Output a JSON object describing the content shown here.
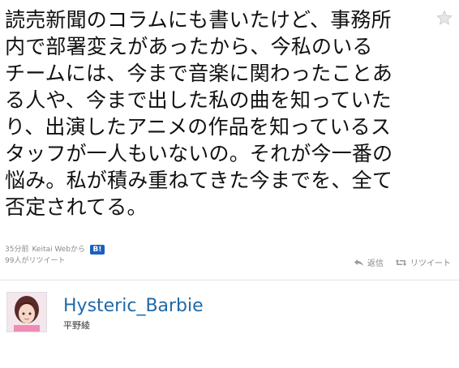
{
  "tweet": {
    "lines": [
      "読売新聞のコラムにも書いたけど、事務所",
      "内で部署変えがあったから、今私のいる",
      "チームには、今まで音楽に関わったことあ",
      "る人や、今まで出した私の曲を知っていた",
      "り、出演したアニメの作品を知っているス",
      "タッフが一人もいないの。それが今一番の",
      "悩み。私が積み重ねてきた今までを、全て",
      "否定されてる。"
    ],
    "time": "35分前",
    "source": "Keitai Webから",
    "badge": "B!",
    "retweet_count": "99人がリツイート",
    "actions": {
      "reply_label": "返信",
      "retweet_label": "リツイート"
    }
  },
  "author": {
    "screen_name": "Hysteric_Barbie",
    "real_name": "平野綾"
  },
  "colors": {
    "link": "#1f6aa8",
    "meta": "#8a8a8a",
    "badge": "#1b5fbf"
  },
  "icons": {
    "favorite": "star-icon",
    "reply": "reply-icon",
    "retweet": "retweet-icon"
  }
}
